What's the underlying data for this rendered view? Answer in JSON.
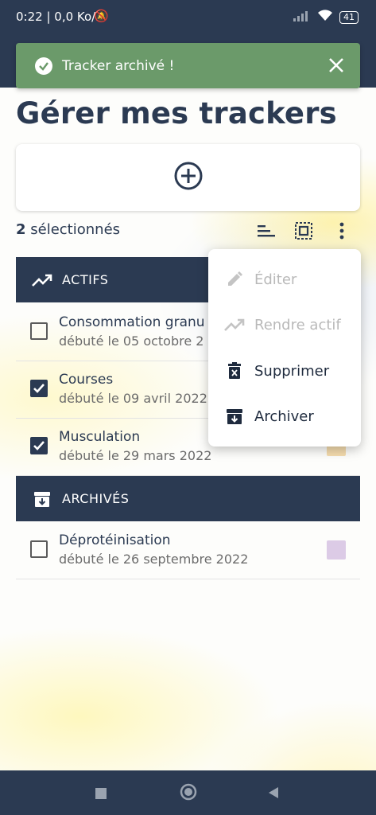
{
  "status_bar": {
    "time_speed": "0:22 | 0,0 Ko/s",
    "battery": "41"
  },
  "snackbar": {
    "message": "Tracker archivé !"
  },
  "page": {
    "title": "Gérer mes trackers"
  },
  "selection": {
    "count": "2",
    "label": " sélectionnés"
  },
  "sections": {
    "active_label": "ACTIFS",
    "archived_label": "ARCHIVÉS"
  },
  "trackers": {
    "active": [
      {
        "title": "Consommation granu",
        "subtitle": "débuté le 05 octobre 2",
        "checked": false,
        "color": "#ffffff"
      },
      {
        "title": "Courses",
        "subtitle": "débuté le 09 avril 2022",
        "checked": true,
        "color": "#ffffff"
      },
      {
        "title": "Musculation",
        "subtitle": "débuté le 29 mars 2022",
        "checked": true,
        "color": "#f5dcae"
      }
    ],
    "archived": [
      {
        "title": "Déprotéinisation",
        "subtitle": "débuté le 26 septembre 2022",
        "checked": false,
        "color": "#dccbe6"
      }
    ]
  },
  "context_menu": {
    "edit": "Éditer",
    "make_active": "Rendre actif",
    "delete": "Supprimer",
    "archive": "Archiver"
  },
  "colors": {
    "primary": "#2b3a52",
    "snackbar": "#6b9a6a"
  }
}
